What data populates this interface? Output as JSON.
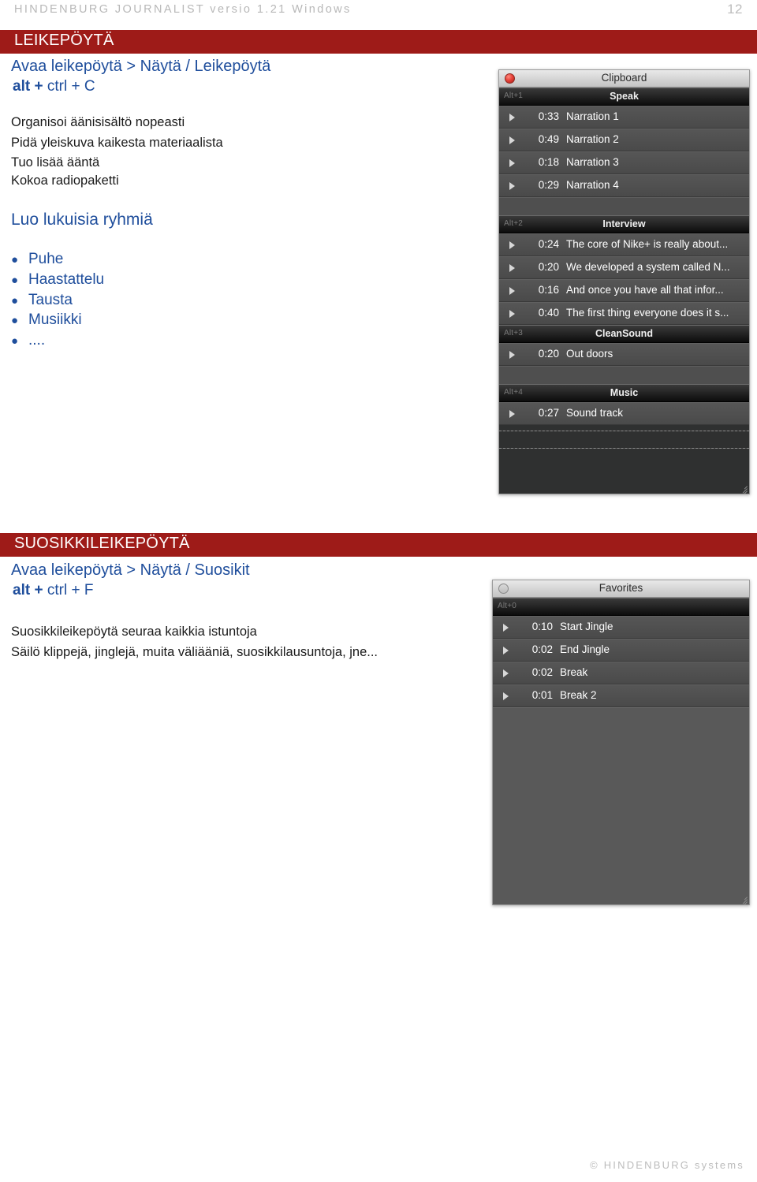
{
  "header": {
    "doc_title": "HINDENBURG JOURNALIST versio 1.21 Windows",
    "page_number": "12"
  },
  "theme": {
    "banner_red": "#9E1B18",
    "link_blue": "#1F4E9C",
    "body_black": "#1A1A1A",
    "header_grey": "#B8B8B8"
  },
  "sections": [
    {
      "banner_title": "LEIKEPÖYTÄ",
      "menu_path": "Avaa leikepöytä > Näytä / Leikepöytä",
      "shortcut": {
        "key1": "alt",
        "plus1": "+",
        "key2": "ctrl",
        "plus2": "+",
        "key3": "C"
      },
      "body_lines": [
        "Organisoi äänisisältö nopeasti",
        "Pidä yleiskuva kaikesta materiaalista",
        "Tuo lisää ääntä",
        "Kokoa radiopaketti"
      ],
      "sub_heading": "Luo lukuisia ryhmiä",
      "bullets": [
        "Puhe",
        "Haastattelu",
        "Tausta",
        "Musiikki",
        "...."
      ]
    },
    {
      "banner_title": "SUOSIKKILEIKEPÖYTÄ",
      "menu_path": "Avaa leikepöytä > Näytä / Suosikit",
      "shortcut": {
        "key1": "alt",
        "plus1": "+",
        "key2": "ctrl",
        "plus2": "+",
        "key3": "F"
      },
      "body_lines": [
        "Suosikkileikepöytä seuraa kaikkia istuntoja",
        "Säilö klippejä, jinglejä, muita väliääniä, suosikkilausuntoja, jne..."
      ]
    }
  ],
  "clipboard_panel": {
    "title": "Clipboard",
    "close_icon": "close-button-red",
    "groups": [
      {
        "hotkey": "Alt+1",
        "name": "Speak",
        "items": [
          {
            "time": "0:33",
            "label": "Narration 1"
          },
          {
            "time": "0:49",
            "label": "Narration 2"
          },
          {
            "time": "0:18",
            "label": "Narration 3"
          },
          {
            "time": "0:29",
            "label": "Narration 4"
          }
        ]
      },
      {
        "hotkey": "Alt+2",
        "name": "Interview",
        "items": [
          {
            "time": "0:24",
            "label": "The core of Nike+ is really about..."
          },
          {
            "time": "0:20",
            "label": "We developed a system called N..."
          },
          {
            "time": "0:16",
            "label": "And once you have all that infor..."
          },
          {
            "time": "0:40",
            "label": "The first thing everyone does it s..."
          }
        ]
      },
      {
        "hotkey": "Alt+3",
        "name": "CleanSound",
        "items": [
          {
            "time": "0:20",
            "label": "Out doors"
          }
        ]
      },
      {
        "hotkey": "Alt+4",
        "name": "Music",
        "items": [
          {
            "time": "0:27",
            "label": "Sound track"
          }
        ]
      }
    ]
  },
  "favorites_panel": {
    "title": "Favorites",
    "close_icon": "close-button-grey",
    "groups": [
      {
        "hotkey": "Alt+0",
        "name": "",
        "items": [
          {
            "time": "0:10",
            "label": "Start Jingle"
          },
          {
            "time": "0:02",
            "label": "End Jingle"
          },
          {
            "time": "0:02",
            "label": "Break"
          },
          {
            "time": "0:01",
            "label": "Break 2"
          }
        ]
      }
    ]
  },
  "footer": {
    "copyright": "© HINDENBURG systems"
  }
}
